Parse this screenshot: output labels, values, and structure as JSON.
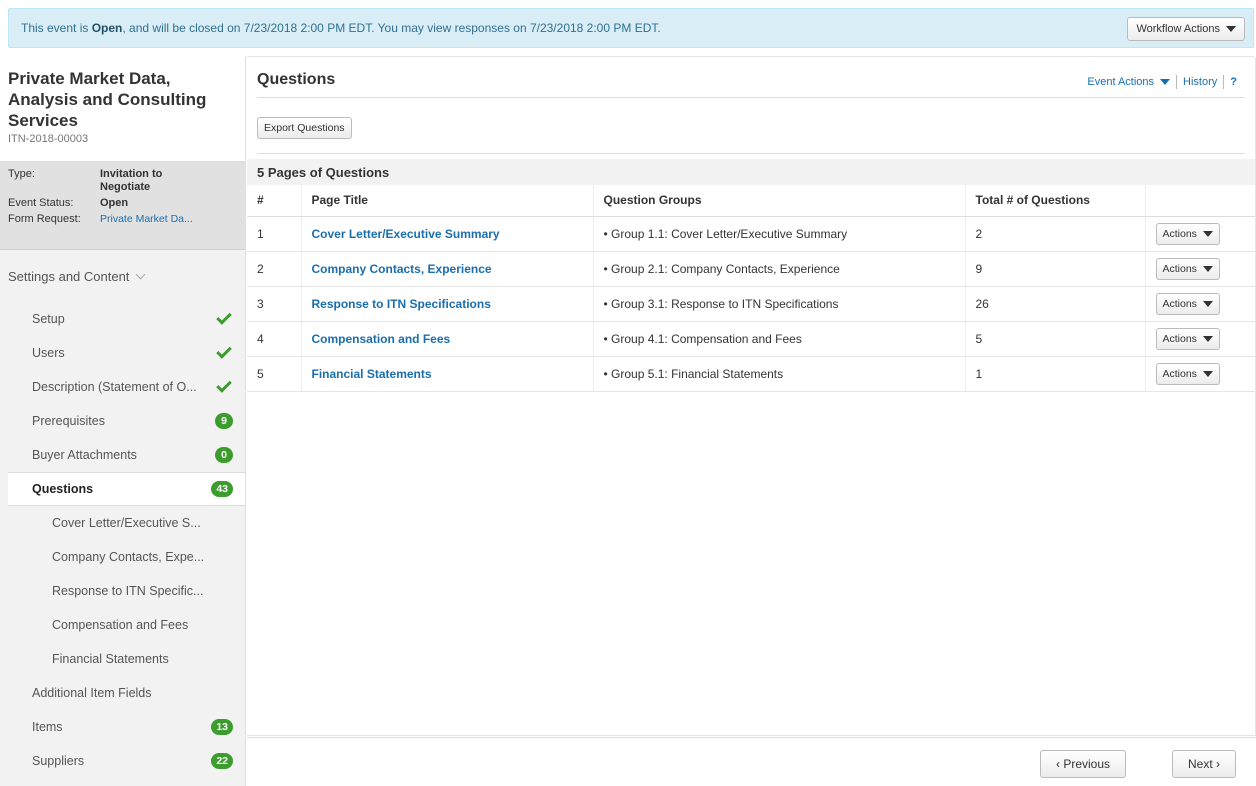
{
  "banner": {
    "prefix": "This event is",
    "status": "Open",
    "suffix": ", and will be closed on 7/23/2018 2:00 PM EDT. You may view responses on 7/23/2018 2:00 PM EDT.",
    "workflow_label": "Workflow Actions"
  },
  "event": {
    "title": "Private Market Data, Analysis and Consulting Services",
    "id": "ITN-2018-00003",
    "type_label": "Type:",
    "type_value": "Invitation to Negotiate",
    "status_label": "Event Status:",
    "status_value": "Open",
    "form_label": "Form Request:",
    "form_value": "Private Market Da..."
  },
  "sidebar": {
    "section_label": "Settings and Content",
    "items": [
      {
        "label": "Setup",
        "indicator": "check"
      },
      {
        "label": "Users",
        "indicator": "check"
      },
      {
        "label": "Description (Statement of O...",
        "indicator": "check"
      },
      {
        "label": "Prerequisites",
        "badge": "9"
      },
      {
        "label": "Buyer Attachments",
        "badge": "0"
      },
      {
        "label": "Questions",
        "badge": "43"
      }
    ],
    "subitems": [
      "Cover Letter/Executive S...",
      "Company Contacts, Expe...",
      "Response to ITN Specific...",
      "Compensation and Fees",
      "Financial Statements"
    ],
    "bottom_items": [
      {
        "label": "Additional Item Fields"
      },
      {
        "label": "Items",
        "badge": "13"
      },
      {
        "label": "Suppliers",
        "badge": "22"
      }
    ]
  },
  "main": {
    "title": "Questions",
    "event_actions": "Event Actions",
    "history": "History",
    "help": "?",
    "export_label": "Export Questions",
    "pages_header": "5 Pages of Questions",
    "columns": [
      "#",
      "Page Title",
      "Question Groups",
      "Total # of Questions"
    ],
    "rows": [
      {
        "num": "1",
        "title": "Cover Letter/Executive Summary",
        "group": "• Group 1.1: Cover Letter/Executive Summary",
        "total": "2",
        "action": "Actions"
      },
      {
        "num": "2",
        "title": "Company Contacts, Experience",
        "group": "• Group 2.1: Company Contacts, Experience",
        "total": "9",
        "action": "Actions"
      },
      {
        "num": "3",
        "title": "Response to ITN Specifications",
        "group": "• Group 3.1: Response to ITN Specifications",
        "total": "26",
        "action": "Actions"
      },
      {
        "num": "4",
        "title": "Compensation and Fees",
        "group": "• Group 4.1: Compensation and Fees",
        "total": "5",
        "action": "Actions"
      },
      {
        "num": "5",
        "title": "Financial Statements",
        "group": "• Group 5.1: Financial Statements",
        "total": "1",
        "action": "Actions"
      }
    ]
  },
  "footer": {
    "previous_label": "‹ Previous",
    "next_label": "Next ›"
  },
  "colors": {
    "accent_link": "#1a6eae",
    "badge_green": "#3c9d2e",
    "banner_bg": "#d9edf7"
  }
}
